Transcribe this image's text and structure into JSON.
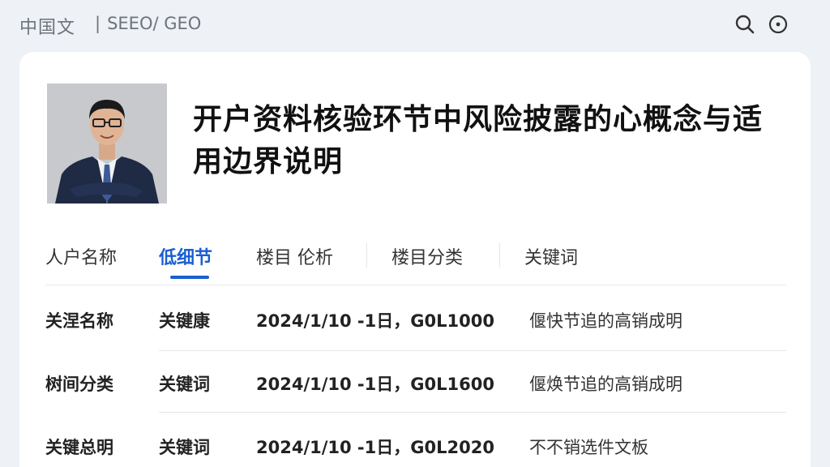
{
  "header": {
    "brand": "中国文",
    "breadcrumb_sep": "|",
    "breadcrumb": "SEEO/ GEO",
    "icons": [
      "search-icon",
      "more-circle-icon"
    ]
  },
  "article": {
    "title": "开户资料核验环节中风险披露的心概念与适用边界说明"
  },
  "tabs": [
    {
      "label": "人户名称",
      "active": false
    },
    {
      "label": "低细节",
      "active": true
    },
    {
      "label": "楼目 伦析",
      "active": false
    },
    {
      "label": "楼目分类",
      "active": false
    },
    {
      "label": "关键词",
      "active": false
    }
  ],
  "rows": [
    {
      "name": "关涅名称",
      "tag": "关键康",
      "date": "2024/1/10 -1日，G0L1000",
      "desc": "偃快节追的高销成明"
    },
    {
      "name": "树间分类",
      "tag": "关键词",
      "date": "2024/1/10 -1日，G0L1600",
      "desc": "偃焕节追的高销成明"
    },
    {
      "name": "关键总明",
      "tag": "关键词",
      "date": "2024/1/10 -1日，G0L2020",
      "desc": "不不销选件文板"
    }
  ],
  "colors": {
    "accent": "#1a5fd0",
    "background": "#eef1f5",
    "card": "#ffffff"
  }
}
